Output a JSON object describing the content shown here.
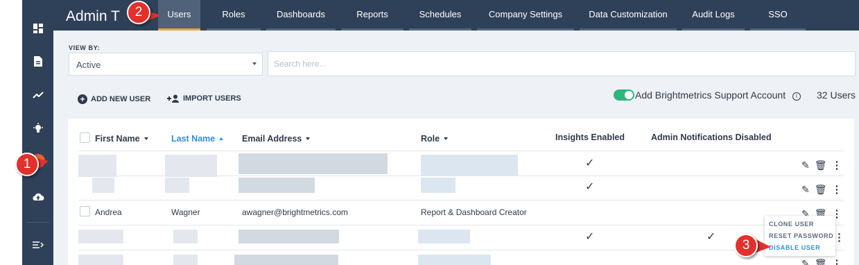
{
  "app": {
    "title": "Admin T"
  },
  "nav": {
    "tabs": [
      {
        "label": "Users",
        "active": true
      },
      {
        "label": "Roles"
      },
      {
        "label": "Dashboards"
      },
      {
        "label": "Reports"
      },
      {
        "label": "Schedules"
      },
      {
        "label": "Company Settings"
      },
      {
        "label": "Data Customization"
      },
      {
        "label": "Audit Logs"
      },
      {
        "label": "SSO"
      }
    ]
  },
  "sidebar": {
    "icons": [
      "dashboard-icon",
      "document-icon",
      "trend-icon",
      "lightbulb-icon",
      "admin-active-icon",
      "cloud-upload-icon",
      "expand-menu-icon"
    ]
  },
  "filter": {
    "view_by_label": "VIEW BY:",
    "view_value": "Active",
    "search_placeholder": "Search here..."
  },
  "actions": {
    "add_user": "ADD NEW USER",
    "import_users": "IMPORT USERS",
    "support_account_label": "Add Brightmetrics Support Account",
    "support_account_enabled": true,
    "user_count": "32 Users"
  },
  "table": {
    "columns": {
      "first_name": "First Name",
      "last_name": "Last Name",
      "email": "Email Address",
      "role": "Role",
      "insights": "Insights Enabled",
      "admin_notifications": "Admin Notifications Disabled"
    },
    "visible_row": {
      "first_name": "Andrea",
      "last_name": "Wagner",
      "email": "awagner@brightmetrics.com",
      "role": "Report & Dashboard Creator"
    },
    "check_mark": "✓"
  },
  "row_menu": {
    "clone": "CLONE USER",
    "reset": "RESET PASSWORD",
    "disable": "DISABLE USER"
  },
  "callouts": [
    "1",
    "2",
    "3"
  ],
  "colors": {
    "nav_bg": "#2f4158",
    "active_tab_underline": "#f0a338",
    "toggle_on": "#2eb67d",
    "sort_active": "#2f8fd8",
    "callout": "#e3302b"
  }
}
